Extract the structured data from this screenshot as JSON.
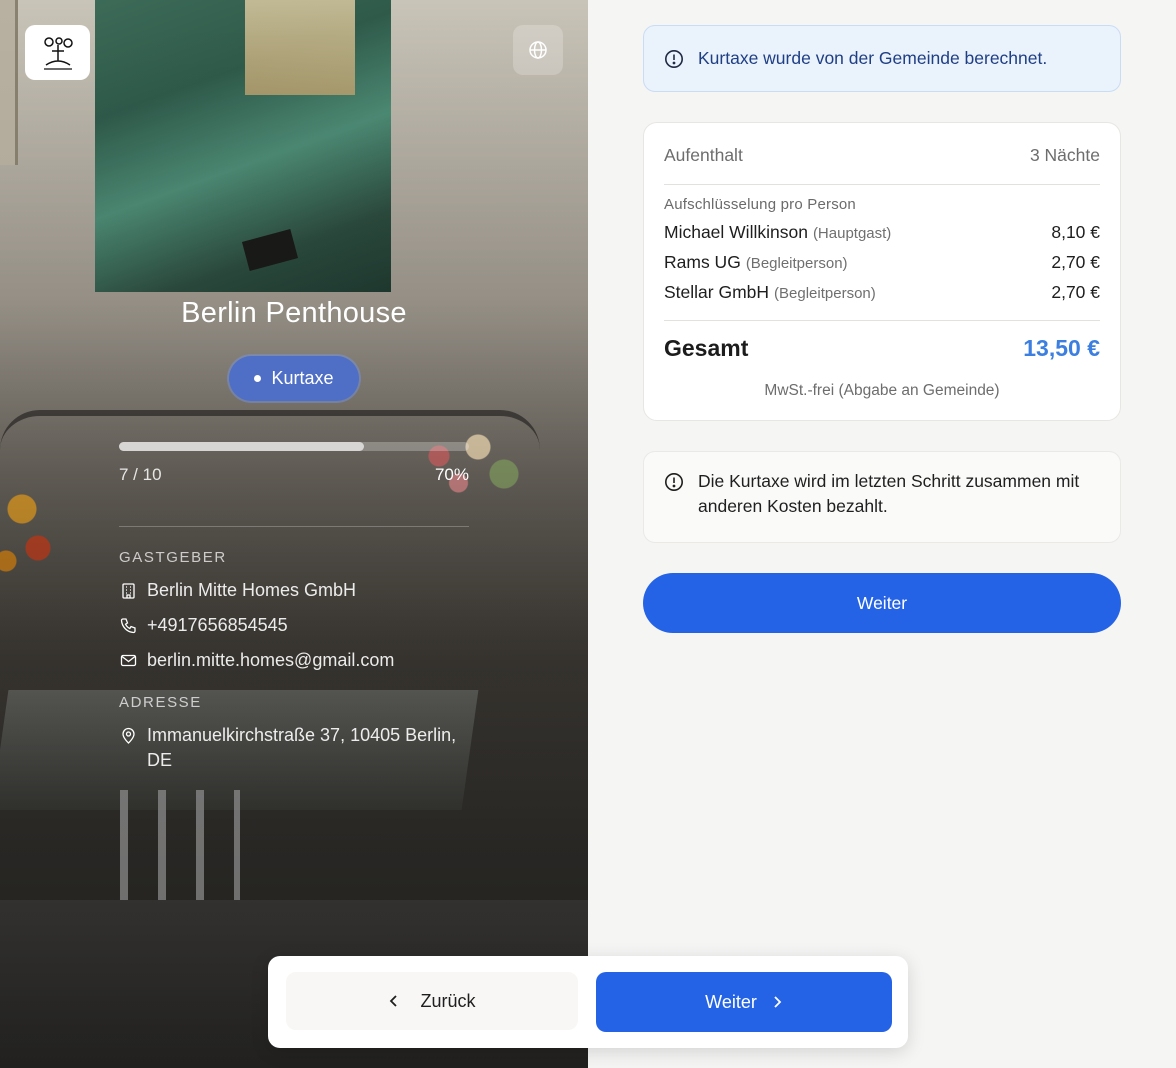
{
  "property": {
    "name": "Berlin Penthouse",
    "badge_label": "Kurtaxe",
    "progress": {
      "current_label": "7 / 10",
      "percent_label": "70%",
      "fraction": 0.7
    }
  },
  "host": {
    "section_label": "GASTGEBER",
    "company": "Berlin Mitte Homes GmbH",
    "phone": "+4917656854545",
    "email": "berlin.mitte.homes@gmail.com"
  },
  "address": {
    "section_label": "ADRESSE",
    "line1": "Immanuelkirchstraße 37, 10405 Berlin,",
    "line2": "DE"
  },
  "notice_top": "Kurtaxe wurde von der Gemeinde berechnet.",
  "summary": {
    "stay_label": "Aufenthalt",
    "stay_value": "3 Nächte",
    "breakdown_title": "Aufschlüsselung pro Person",
    "persons": [
      {
        "name": "Michael Willkinson",
        "role": "(Hauptgast)",
        "amount": "8,10 €"
      },
      {
        "name": "Rams UG",
        "role": "(Begleitperson)",
        "amount": "2,70 €"
      },
      {
        "name": "Stellar GmbH",
        "role": "(Begleitperson)",
        "amount": "2,70 €"
      }
    ],
    "total_label": "Gesamt",
    "total_value": "13,50 €",
    "vat_note": "MwSt.-frei (Abgabe an Gemeinde)"
  },
  "notice_bottom": "Die Kurtaxe wird im letzten Schritt zusammen mit anderen Kosten bezahlt.",
  "primary_button": "Weiter",
  "nav": {
    "back_label": "Zurück",
    "next_label": "Weiter"
  },
  "colors": {
    "primary": "#2563e6",
    "total_accent": "#3c7fe0",
    "badge": "#4f6fc6",
    "info_blue_bg": "#eaf2fc"
  },
  "icons": [
    "logo-icon",
    "globe-icon",
    "building-icon",
    "phone-icon",
    "mail-icon",
    "map-pin-icon",
    "info-icon",
    "chevron-left-icon",
    "chevron-right-icon"
  ]
}
